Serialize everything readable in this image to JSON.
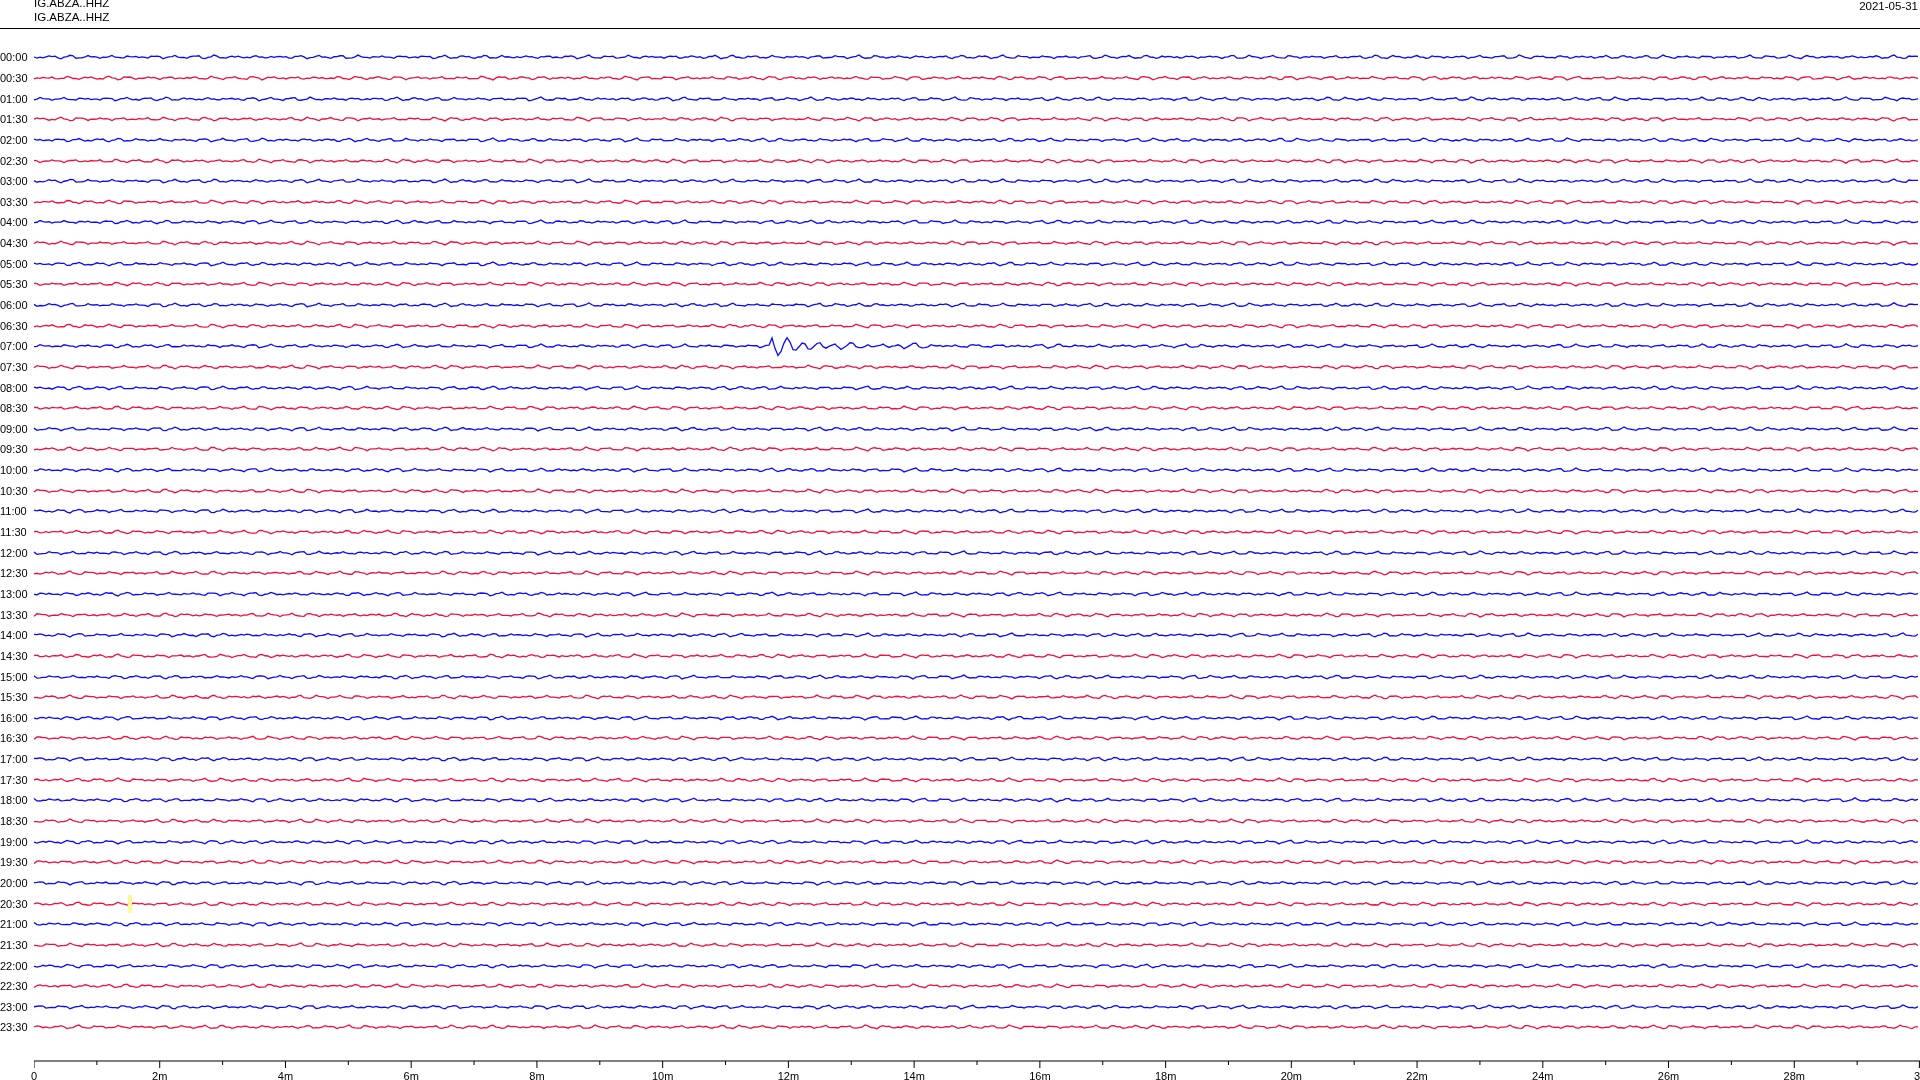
{
  "header": {
    "station_lines": [
      "IG.ABZA..HHZ",
      "IG.ABZA..HHZ"
    ],
    "date": "2021-05-31"
  },
  "rows": [
    {
      "time": "00:00",
      "color": "#0a0aff",
      "kind": "noise"
    },
    {
      "time": "00:30",
      "color": "#f0103a",
      "kind": "noise"
    },
    {
      "time": "01:00",
      "color": "#0a0aff",
      "kind": "noise"
    },
    {
      "time": "01:30",
      "color": "#f0103a",
      "kind": "noise"
    },
    {
      "time": "02:00",
      "color": "#0a0aff",
      "kind": "noise"
    },
    {
      "time": "02:30",
      "color": "#f0103a",
      "kind": "noise"
    },
    {
      "time": "03:00",
      "color": "#0a0aff",
      "kind": "noise"
    },
    {
      "time": "03:30",
      "color": "#f0103a",
      "kind": "noise"
    },
    {
      "time": "04:00",
      "color": "#0a0aff",
      "kind": "noise"
    },
    {
      "time": "04:30",
      "color": "#f0103a",
      "kind": "noise"
    },
    {
      "time": "05:00",
      "color": "#0a0aff",
      "kind": "noise"
    },
    {
      "time": "05:30",
      "color": "#f0103a",
      "kind": "noise"
    },
    {
      "time": "06:00",
      "color": "#0a0aff",
      "kind": "noise"
    },
    {
      "time": "06:30",
      "color": "#f0103a",
      "kind": "noise"
    },
    {
      "time": "07:00",
      "color": "#0a0aff",
      "kind": "event"
    },
    {
      "time": "07:30",
      "color": "#f0103a",
      "kind": "noise"
    },
    {
      "time": "08:00",
      "color": "#0a0aff",
      "kind": "noise"
    },
    {
      "time": "08:30",
      "color": "#f0103a",
      "kind": "noise"
    },
    {
      "time": "09:00",
      "color": "#0a0aff",
      "kind": "noise"
    },
    {
      "time": "09:30",
      "color": "#f0103a",
      "kind": "noise"
    },
    {
      "time": "10:00",
      "color": "#0a0aff",
      "kind": "noise"
    },
    {
      "time": "10:30",
      "color": "#f0103a",
      "kind": "noise"
    },
    {
      "time": "11:00",
      "color": "#0a0aff",
      "kind": "noise"
    },
    {
      "time": "11:30",
      "color": "#f0103a",
      "kind": "noise"
    },
    {
      "time": "12:00",
      "color": "#0a0aff",
      "kind": "noise"
    },
    {
      "time": "12:30",
      "color": "#f0103a",
      "kind": "noise"
    },
    {
      "time": "13:00",
      "color": "#0a0aff",
      "kind": "noise"
    },
    {
      "time": "13:30",
      "color": "#f0103a",
      "kind": "noise"
    },
    {
      "time": "14:00",
      "color": "#0a0aff",
      "kind": "noise"
    },
    {
      "time": "14:30",
      "color": "#f0103a",
      "kind": "noise"
    },
    {
      "time": "15:00",
      "color": "#0a0aff",
      "kind": "noise"
    },
    {
      "time": "15:30",
      "color": "#f0103a",
      "kind": "noise"
    },
    {
      "time": "16:00",
      "color": "#0a0aff",
      "kind": "noise"
    },
    {
      "time": "16:30",
      "color": "#f0103a",
      "kind": "noise"
    },
    {
      "time": "17:00",
      "color": "#0a0aff",
      "kind": "noise"
    },
    {
      "time": "17:30",
      "color": "#f0103a",
      "kind": "noise"
    },
    {
      "time": "18:00",
      "color": "#0a0aff",
      "kind": "noise"
    },
    {
      "time": "18:30",
      "color": "#f0103a",
      "kind": "noise"
    },
    {
      "time": "19:00",
      "color": "#0a0aff",
      "kind": "noise"
    },
    {
      "time": "19:30",
      "color": "#f0103a",
      "kind": "noise"
    },
    {
      "time": "20:00",
      "color": "#0a0aff",
      "kind": "noise"
    },
    {
      "time": "20:30",
      "color": "#f0103a",
      "kind": "marked"
    },
    {
      "time": "21:00",
      "color": "#0a0aff",
      "kind": "noise"
    },
    {
      "time": "21:30",
      "color": "#f0103a",
      "kind": "noise"
    },
    {
      "time": "22:00",
      "color": "#0a0aff",
      "kind": "noise"
    },
    {
      "time": "22:30",
      "color": "#f0103a",
      "kind": "noise"
    },
    {
      "time": "23:00",
      "color": "#0a0aff",
      "kind": "noise"
    },
    {
      "time": "23:30",
      "color": "#f0103a",
      "kind": "noise"
    }
  ],
  "x_axis": {
    "labels": [
      "0",
      "2m",
      "4m",
      "6m",
      "8m",
      "10m",
      "12m",
      "14m",
      "16m",
      "18m",
      "20m",
      "22m",
      "24m",
      "26m",
      "28m",
      "3"
    ]
  }
}
